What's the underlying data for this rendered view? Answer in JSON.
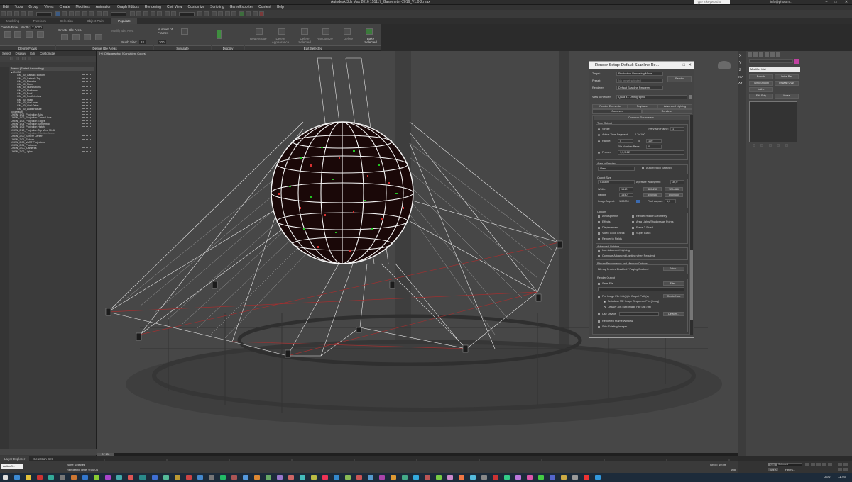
{
  "window": {
    "title": "Autodesk 3ds Max 2016    151117_Gasometer-2016_V1.0-2.max",
    "search_placeholder": "Type a keyword or phrase",
    "user": "info@photom...",
    "controls": [
      "–",
      "□",
      "✕"
    ]
  },
  "menu": [
    "Edit",
    "Tools",
    "Group",
    "Views",
    "Create",
    "Modifiers",
    "Animation",
    "Graph Editors",
    "Rendering",
    "Civil View",
    "Customize",
    "Scripting",
    "GameExporter",
    "Content",
    "Help"
  ],
  "ribbon_tabs": [
    "Modeling",
    "Freeform",
    "Selection",
    "Object Paint",
    "Populate"
  ],
  "ribbon_active_tab": "Populate",
  "ribbon": {
    "create_flow": "Create Flow",
    "width_label": "Width:",
    "width_value": "7,0000",
    "create_idle_area": "Create Idle Area",
    "modify_idle_area": "Modify Idle Area",
    "brush_size_label": "Brush Size:",
    "brush_size_value": "24",
    "num_frames_label": "Number of Frames",
    "num_frames_value": "300",
    "regenerate": "Regenerate",
    "delete_appearance": "Delete Appearance",
    "delete_selected": "Delete Selected",
    "randomize": "Randomize",
    "delete": "Delete",
    "bake_selected": "Bake Selected",
    "sections": [
      "Define Flows",
      "Define Idle Areas",
      "Simulate",
      "Display",
      "Edit Selected"
    ]
  },
  "explorer": {
    "menu": [
      "Select",
      "Display",
      "Edit",
      "Customize"
    ],
    "header": "Name (Sorted Ascending)",
    "items": [
      "▸ GM 30",
      "GM_30_Catwalk Bottom",
      "GM_30_Catwalk Top",
      "GM_30_Elevator",
      "GM_30_Floor",
      "GM_30_Illuminations",
      "GM_30_Platforms",
      "GM_30_Roof",
      "GM_30_Roofinteriors",
      "GM_30_Stage",
      "GM_30_Wall Inner",
      "GM_30_Wall Outer",
      "GM_30_Wallstructure",
      "0 (default)",
      "JHEN_1.01_Projection Axis",
      "JHEN_1.02_Projection Central Axis",
      "JHEN_1.03_Projection Edges",
      "JHEN_1.04_Projection Tangential",
      "JHEN_1.05_Projection Hatch",
      "JHEN_2.12_Projection Top View 90-88",
      "JHEN_2.01_Projection Effective Model",
      "JHEN_2.00_Sphere Center",
      "JHEN_2.01_Sphere",
      "JHEN_2.03_VART Projectors",
      "JHEN_2.04_Platforms",
      "JHEN_2.0C_Cameras",
      "JHEN_2.02_Lights"
    ]
  },
  "viewport": {
    "label": "[+] [Orthographic] [Consistent Colors]"
  },
  "render_setup": {
    "title": "Render Setup: Default Scanline Re...",
    "target_label": "Target:",
    "target_value": "Production Rendering Mode",
    "preset_label": "Preset:",
    "preset_value": "No preset selected",
    "renderer_label": "Renderer:",
    "renderer_value": "Default Scanline Renderer",
    "render_button": "Render",
    "view_label": "View to Render:",
    "view_value": "Quad 4 - Orthographic",
    "tabs_row1": [
      "Render Elements",
      "Raytracer",
      "Advanced Lighting"
    ],
    "tabs_row2": [
      "Common",
      "Renderer"
    ],
    "rollout_title": "Common Parameters",
    "time_output": "Time Output",
    "single": "Single",
    "every_nth": "Every Nth Frame:",
    "every_nth_value": "1",
    "active_segment": "Active Time Segment:",
    "active_segment_value": "0 To 100",
    "range": "Range:",
    "range_from": "0",
    "range_to_label": "To",
    "range_to": "100",
    "file_number_base": "File Number Base:",
    "file_number_base_value": "0",
    "frames_label": "Frames",
    "frames_value": "1,3,5-12",
    "area_to_render": "Area to Render",
    "area_value": "View",
    "auto_region": "Auto Region Selected",
    "output_size": "Output Size",
    "output_preset": "Custom",
    "aperture_label": "Aperture Width(mm):",
    "aperture_value": "36,0",
    "width_label": "Width:",
    "width_value": "1640",
    "height_label": "Height:",
    "height_value": "1440",
    "size_presets": [
      "320x240",
      "720x486",
      "640x480",
      "800x600"
    ],
    "image_aspect_label": "Image Aspect:",
    "image_aspect_value": "1,00000",
    "pixel_aspect_label": "Pixel Aspect:",
    "pixel_aspect_value": "1,0",
    "options": "Options",
    "opt_left": [
      "Atmospherics",
      "Effects",
      "Displacement",
      "Video Color Check",
      "Render to Fields"
    ],
    "opt_right": [
      "Render Hidden Geometry",
      "Area Lights/Shadows as Points",
      "Force 2-Sided",
      "Super Black"
    ],
    "adv_lighting": "Advanced Lighting",
    "use_adv": "Use Advanced Lighting",
    "compute_adv": "Compute Advanced Lighting when Required",
    "bitmap_perf": "Bitmap Performance and Memory Options",
    "bitmap_proxies": "Bitmap Proxies Disabled / Paging Enabled",
    "setup_button": "Setup...",
    "render_output": "Render Output",
    "save_file": "Save File",
    "files_button": "Files...",
    "put_image": "Put Image File List(s) in Output Path(s)",
    "create_now": "Create Now",
    "autodesk_seq": "Autodesk ME Image Sequence File (.imsq)",
    "legacy": "Legacy 3ds Max Image File List (.ifl)",
    "use_device": "Use Device",
    "devices_button": "Devices...",
    "rendered_frame_window": "Rendered Frame Window",
    "skip_existing": "Skip Existing Images"
  },
  "command_panel": {
    "xyz": [
      "X",
      "Y",
      "Z",
      "XY",
      "XY"
    ],
    "modifier_list": "Modifier List",
    "buttons": [
      "Extrude",
      "Lathe Pan",
      "TurboSmooth",
      "Unwrap UVW",
      "Lathe",
      "Edit Poly",
      "Noise"
    ]
  },
  "timeline": {
    "frame": "0 / 100"
  },
  "status": {
    "layer_explorer": "Layer Explorer",
    "selection_set": "Selection Set",
    "none_selected": "None Selected",
    "rendering_time": "Rendering Time: 0:00:04",
    "script_field": "ActionS...",
    "grid": "Grid = 10,0m",
    "add_time_tag": "Add Time Tag",
    "auto": "Auto",
    "selected": "Selected",
    "set_key": "Set K",
    "filters": "Filters..."
  },
  "taskbar": {
    "lang": "DEU",
    "time": "11:46"
  }
}
